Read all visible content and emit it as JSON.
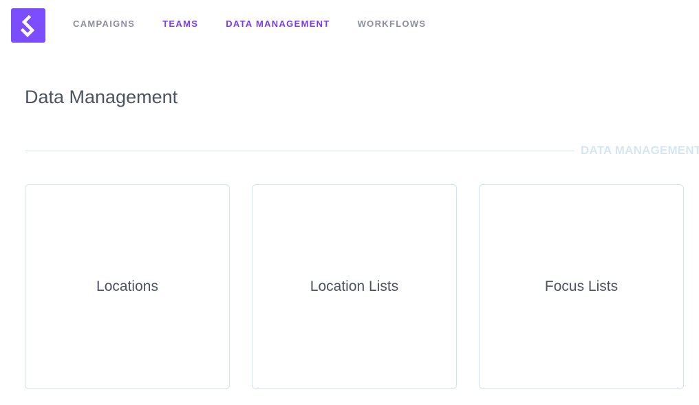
{
  "brand": {
    "logo_icon": "diamond-arrow-logo-icon",
    "color": "#7b4dff"
  },
  "nav": {
    "items": [
      {
        "label": "CAMPAIGNS"
      },
      {
        "label": "TEAMS"
      },
      {
        "label": "DATA MANAGEMENT"
      },
      {
        "label": "WORKFLOWS"
      }
    ],
    "active_color": "#7c3aed",
    "inactive_color": "#8a8fa3"
  },
  "page": {
    "title": "Data Management",
    "section_label": "DATA MANAGEMENT"
  },
  "cards": [
    {
      "label": "Locations"
    },
    {
      "label": "Location Lists"
    },
    {
      "label": "Focus Lists"
    }
  ]
}
